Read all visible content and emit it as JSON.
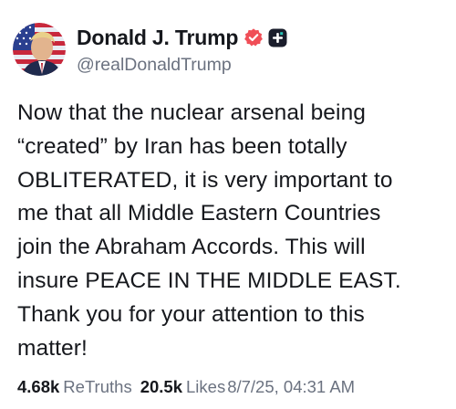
{
  "author": {
    "display_name": "Donald J. Trump",
    "handle": "@realDonaldTrump",
    "avatar_icon": "profile-photo-flag-background",
    "verified_icon": "verified-badge-icon",
    "verified_color": "#f04e57",
    "plus_icon": "subscriber-plus-icon"
  },
  "post": {
    "lines": [
      "Now that the nuclear arsenal being",
      "“created” by Iran has been totally",
      "OBLITERATED, it is very important to",
      "me that all Middle Eastern Countries",
      "join the Abraham Accords. This will",
      "insure PEACE IN THE MIDDLE EAST.",
      "Thank you for your attention to this",
      "matter!"
    ]
  },
  "stats": {
    "retruths_count": "4.68k",
    "retruths_label": "ReTruths",
    "likes_count": "20.5k",
    "likes_label": "Likes",
    "timestamp": "8/7/25, 04:31 AM"
  }
}
